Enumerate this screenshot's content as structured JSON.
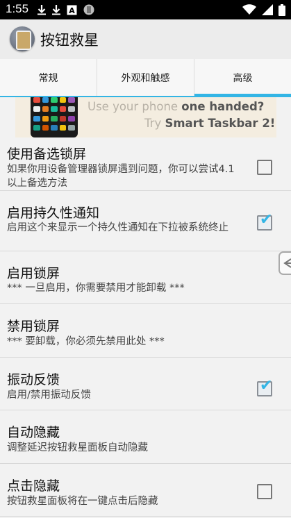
{
  "status_bar": {
    "time": "1:55",
    "left_icons": [
      "download-icon",
      "download-icon",
      "a-icon",
      "circle-app-icon"
    ],
    "right_icons": [
      "wifi-icon",
      "cell-signal-icon",
      "battery-icon"
    ]
  },
  "app": {
    "title": "按钮救星",
    "icon": "app-icon"
  },
  "tabs": [
    {
      "label": "常规",
      "active": false
    },
    {
      "label": "外观和触感",
      "active": false
    },
    {
      "label": "高级",
      "active": true
    }
  ],
  "accent_color": "#33b5e5",
  "banner": {
    "line1_prefix": "Use your phone ",
    "line1_bold": "one handed?",
    "line2_prefix": "Try ",
    "line2_bold": "Smart Taskbar 2!"
  },
  "settings": [
    {
      "title": "使用备选锁屏",
      "summary": "如果你用设备管理器锁屏遇到问题，你可以尝试4.1以上备选方法",
      "checkbox": true,
      "checked": false
    },
    {
      "title": "启用持久性通知",
      "summary": "启用这个来显示一个持久性通知在下拉被系统终止",
      "checkbox": true,
      "checked": true
    },
    {
      "title": "启用锁屏",
      "summary": "*** 一旦启用，你需要禁用才能卸载 ***",
      "checkbox": false
    },
    {
      "title": "禁用锁屏",
      "summary": "*** 要卸载，你必须先禁用此处 ***",
      "checkbox": false
    },
    {
      "title": "振动反馈",
      "summary": "启用/禁用振动反馈",
      "checkbox": true,
      "checked": true
    },
    {
      "title": "自动隐藏",
      "summary": "调整延迟按钮救星面板自动隐藏",
      "checkbox": false
    },
    {
      "title": "点击隐藏",
      "summary": "按钮救星面板将在一键点击后隐藏",
      "checkbox": true,
      "checked": false
    }
  ],
  "side_handle": {
    "icon": "arrow-left-icon"
  }
}
